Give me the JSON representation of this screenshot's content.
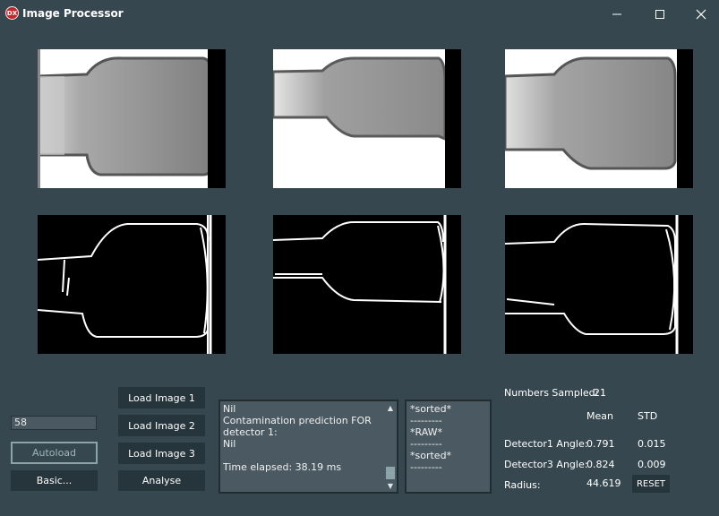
{
  "window": {
    "title": "Image Processor",
    "logo_text": "DX",
    "minimize_icon": "minimize-icon",
    "maximize_icon": "maximize-icon",
    "close_icon": "close-icon"
  },
  "controls": {
    "threshold_value": "58",
    "autoload_label": "Autoload",
    "basic_label": "Basic...",
    "load_image_1_label": "Load Image 1",
    "load_image_2_label": "Load Image 2",
    "load_image_3_label": "Load Image 3",
    "analyse_label": "Analyse"
  },
  "log_box": {
    "lines": [
      "Nil",
      "Contamination prediction FOR",
      "detector 1:",
      "Nil",
      "",
      "Time elapsed: 38.19 ms"
    ],
    "scroll_up_icon": "chevron-up-icon",
    "scroll_down_icon": "chevron-down-icon"
  },
  "list_box": {
    "lines": [
      "*sorted*",
      "---------",
      "*RAW*",
      "---------",
      "*sorted*",
      "---------"
    ]
  },
  "stats": {
    "numbers_sampled_label": "Numbers Sampled:",
    "numbers_sampled_value": "21",
    "mean_header": "Mean",
    "std_header": "STD",
    "detector1_label": "Detector1 Angle:",
    "detector1_mean": "0.791",
    "detector1_std": "0.015",
    "detector3_label": "Detector3 Angle:",
    "detector3_mean": "0.824",
    "detector3_std": "0.009",
    "radius_label": "Radius:",
    "radius_value": "44.619",
    "reset_label": "RESET"
  },
  "colors": {
    "background": "#37474f",
    "button": "#26343b",
    "textbox": "#4b5a62",
    "accent_outline": "#8aa4a8"
  }
}
